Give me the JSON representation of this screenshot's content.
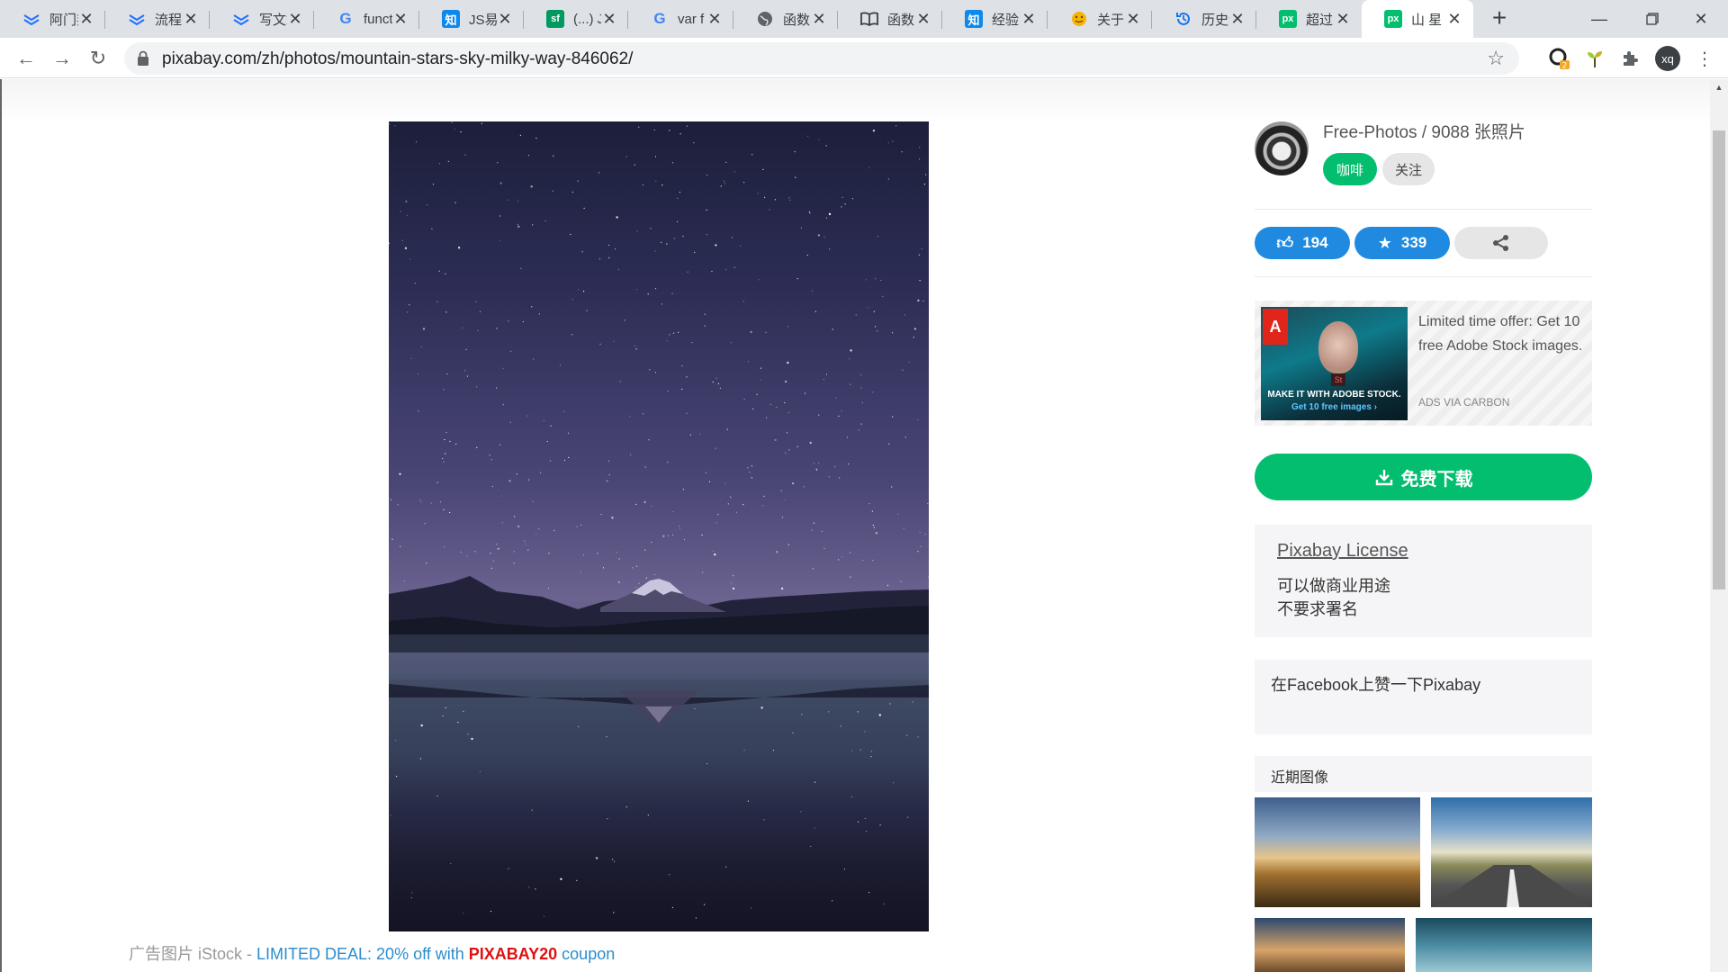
{
  "tabs": [
    {
      "title": "阿门邦",
      "icon": "yuque-icon",
      "color": "#1e6fff"
    },
    {
      "title": "流程图",
      "icon": "yuque-icon",
      "color": "#1e6fff"
    },
    {
      "title": "写文章",
      "icon": "yuque-icon",
      "color": "#1e6fff"
    },
    {
      "title": "function",
      "icon": "google-icon",
      "color": "#4285f4"
    },
    {
      "title": "JS易错",
      "icon": "zhihu-icon",
      "color": "#0f88eb",
      "glyph": "知"
    },
    {
      "title": "(...) JS",
      "icon": "segmentfault-icon",
      "color": "#009a61",
      "glyph": "sf"
    },
    {
      "title": "var f",
      "icon": "google-icon",
      "color": "#4285f4"
    },
    {
      "title": "函数表",
      "icon": "globe-icon",
      "color": "#5f6368"
    },
    {
      "title": "函数的",
      "icon": "book-icon",
      "color": "#3c4043"
    },
    {
      "title": "经验",
      "icon": "zhihu-icon",
      "color": "#0f88eb",
      "glyph": "知"
    },
    {
      "title": "关于",
      "icon": "emoji-icon",
      "color": "#f5b400"
    },
    {
      "title": "历史记",
      "icon": "history-icon",
      "color": "#1a73e8"
    },
    {
      "title": "超过",
      "icon": "pixabay-icon",
      "color": "#02be6e",
      "glyph": "px"
    },
    {
      "title": "山 星",
      "icon": "pixabay-icon",
      "color": "#02be6e",
      "glyph": "px",
      "active": true
    }
  ],
  "browser": {
    "url": "pixabay.com/zh/photos/mountain-stars-sky-milky-way-846062/",
    "profile": "xq",
    "extension_badge": "2"
  },
  "author": {
    "name": "Free-Photos / 9088 张照片",
    "coffee_label": "咖啡",
    "follow_label": "关注"
  },
  "stats": {
    "likes": "194",
    "favorites": "339"
  },
  "ad": {
    "text": "Limited time offer: Get 10 free Adobe Stock images.",
    "via": "ADS VIA CARBON",
    "image_caption_1": "MAKE IT WITH ADOBE STOCK.",
    "image_caption_2": "Get 10 free images ›",
    "logo_text": "A",
    "badge_text": "St"
  },
  "download_label": "免费下载",
  "license": {
    "title": "Pixabay License",
    "line1": "可以做商业用途",
    "line2": "不要求署名"
  },
  "facebook_text": "在Facebook上赞一下Pixabay",
  "recent_title": "近期图像",
  "promo": {
    "prefix": "广告图片 iStock - ",
    "deal": "LIMITED DEAL: 20% off with ",
    "code": "PIXABAY20",
    "suffix": " coupon"
  },
  "colors": {
    "accent_green": "#02be6e",
    "like_blue": "#1f8ae0",
    "promo_red": "#e01010",
    "promo_blue": "#2c8ccc"
  }
}
